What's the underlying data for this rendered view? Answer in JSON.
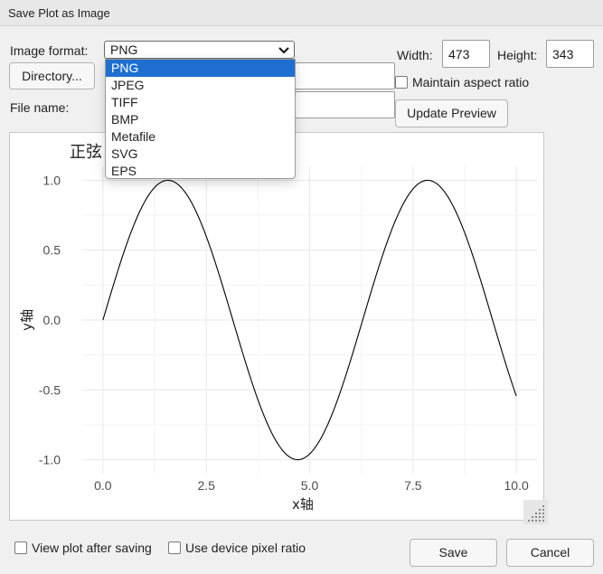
{
  "window": {
    "title": "Save Plot as Image"
  },
  "form": {
    "format_label": "Image format:",
    "format_value": "PNG",
    "format_options": [
      "PNG",
      "JPEG",
      "TIFF",
      "BMP",
      "Metafile",
      "SVG",
      "EPS"
    ],
    "directory_button": "Directory...",
    "filename_label": "File name:",
    "width_label": "Width:",
    "width_value": "473",
    "height_label": "Height:",
    "height_value": "343",
    "maintain_aspect_label": "Maintain aspect ratio",
    "update_preview_button": "Update Preview",
    "view_after_saving_label": "View plot after saving",
    "device_pixel_ratio_label": "Use device pixel ratio",
    "save_button": "Save",
    "cancel_button": "Cancel"
  },
  "chart_data": {
    "type": "line",
    "title": "正弦",
    "xlabel": "x轴",
    "ylabel": "y轴",
    "function": "sin(x)",
    "xlim": [
      0,
      10
    ],
    "ylim": [
      -1,
      1
    ],
    "xticks": [
      0.0,
      2.5,
      5.0,
      7.5,
      10.0
    ],
    "xtick_labels": [
      "0.0",
      "2.5",
      "5.0",
      "7.5",
      "10.0"
    ],
    "yticks": [
      1.0,
      0.5,
      0.0,
      -0.5,
      -1.0
    ],
    "ytick_labels": [
      "1.0",
      "0.5",
      "0.0",
      "-0.5",
      "-1.0"
    ],
    "grid": true,
    "series": [
      {
        "x": [
          0,
          0.5,
          1.0,
          1.5,
          2.0,
          2.5,
          3.0,
          3.5,
          4.0,
          4.5,
          5.0,
          5.5,
          6.0,
          6.5,
          7.0,
          7.5,
          8.0,
          8.5,
          9.0,
          9.5,
          10.0
        ],
        "values": [
          0,
          0.479,
          0.841,
          0.997,
          0.909,
          0.598,
          0.141,
          -0.351,
          -0.757,
          -0.978,
          -0.959,
          -0.706,
          -0.279,
          0.215,
          0.657,
          0.938,
          0.989,
          0.798,
          0.412,
          -0.075,
          -0.544
        ]
      }
    ],
    "colors": {
      "line": "#000000",
      "grid": "#ebebeb",
      "panel": "#ffffff"
    }
  }
}
